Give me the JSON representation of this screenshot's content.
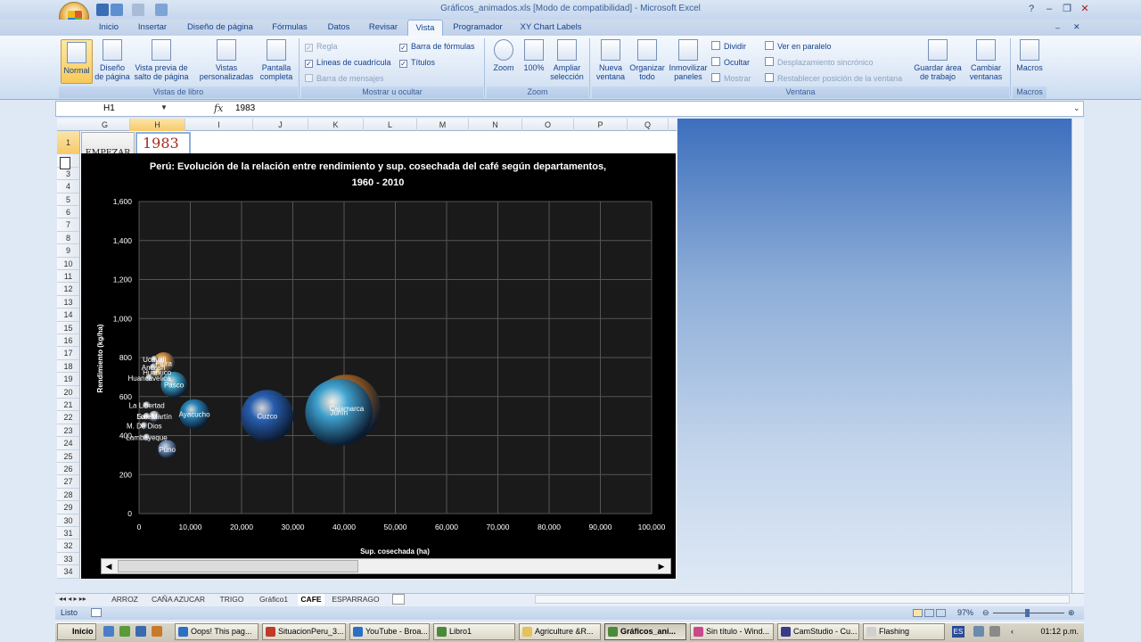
{
  "window": {
    "title": "Gráficos_animados.xls  [Modo de compatibilidad] - Microsoft Excel"
  },
  "ribbon": {
    "tabs": [
      "Inicio",
      "Insertar",
      "Diseño de página",
      "Fórmulas",
      "Datos",
      "Revisar",
      "Vista",
      "Programador",
      "XY Chart Labels"
    ],
    "active_tab": "Vista",
    "groups": {
      "vistas_libro": {
        "label": "Vistas de libro",
        "normal": "Normal",
        "diseno": "Diseño de página",
        "vista_previa": "Vista previa de salto de página",
        "vistas_pers": "Vistas personalizadas",
        "pantalla": "Pantalla completa"
      },
      "mostrar": {
        "label": "Mostrar u ocultar",
        "regla": "Regla",
        "lineas": "Líneas de cuadrícula",
        "barra_mensajes": "Barra de mensajes",
        "barra_formulas": "Barra de fórmulas",
        "titulos": "Títulos"
      },
      "zoom": {
        "label": "Zoom",
        "zoom": "Zoom",
        "cien": "100%",
        "ampliar": "Ampliar selección"
      },
      "ventana": {
        "label": "Ventana",
        "nueva": "Nueva ventana",
        "organizar": "Organizar todo",
        "inmovilizar": "Inmovilizar paneles",
        "dividir": "Dividir",
        "ocultar": "Ocultar",
        "mostrar": "Mostrar",
        "paralelo": "Ver en paralelo",
        "sincronico": "Desplazamiento sincrónico",
        "restablecer": "Restablecer posición de la ventana",
        "guardar": "Guardar área de trabajo",
        "cambiar": "Cambiar ventanas"
      },
      "macros": {
        "label": "Macros",
        "macros": "Macros"
      }
    }
  },
  "formula_bar": {
    "name_box": "H1",
    "fx": "fx",
    "value": "1983"
  },
  "sheet": {
    "columns": [
      "G",
      "H",
      "I",
      "J",
      "K",
      "L",
      "M",
      "N",
      "O",
      "P",
      "Q"
    ],
    "rows": [
      "1",
      "2",
      "3",
      "4",
      "5",
      "6",
      "7",
      "8",
      "9",
      "10",
      "11",
      "12",
      "13",
      "14",
      "15",
      "16",
      "17",
      "18",
      "19",
      "20",
      "21",
      "22",
      "23",
      "24",
      "25",
      "26",
      "27",
      "28",
      "29",
      "30",
      "31",
      "32",
      "33",
      "34"
    ],
    "button_label": "EMPEZAR",
    "year_value": "1983"
  },
  "chart_data": {
    "type": "scatter",
    "title": "Perú: Evolución de la relación entre rendimiento y sup. cosechada del café según departamentos, 1960 - 2010",
    "xlabel": "Sup. cosechada  (ha)",
    "ylabel": "Rendimiento  (kg/ha)",
    "xlim": [
      0,
      100000
    ],
    "ylim": [
      0,
      1600
    ],
    "x_ticks": [
      "0",
      "10,000",
      "20,000",
      "30,000",
      "40,000",
      "50,000",
      "60,000",
      "70,000",
      "80,000",
      "90,000",
      "100,000"
    ],
    "y_ticks": [
      "0",
      "200",
      "400",
      "600",
      "800",
      "1,000",
      "1,200",
      "1,400",
      "1,600"
    ],
    "grid": true,
    "points": [
      {
        "label": "Cajamarca",
        "x": 40500,
        "y": 540,
        "r": 9,
        "color": "#c66d17"
      },
      {
        "label": "Junín",
        "x": 39000,
        "y": 520,
        "r": 9,
        "color": "#3aa4d6"
      },
      {
        "label": "Cuzco",
        "x": 25000,
        "y": 500,
        "r": 7,
        "color": "#2a62b8"
      },
      {
        "label": "Ayacucho",
        "x": 10800,
        "y": 510,
        "r": 4,
        "color": "#2a8bc0"
      },
      {
        "label": "Pasco",
        "x": 6800,
        "y": 660,
        "r": 3.5,
        "color": "#3fa8cc"
      },
      {
        "label": "Piura",
        "x": 4800,
        "y": 770,
        "r": 3,
        "color": "#e39a44"
      },
      {
        "label": "Ucayali",
        "x": 3000,
        "y": 790,
        "r": 1,
        "color": "#cccccc"
      },
      {
        "label": "Ancash",
        "x": 2800,
        "y": 750,
        "r": 1,
        "color": "#cccccc"
      },
      {
        "label": "Huánuco",
        "x": 3500,
        "y": 725,
        "r": 1.5,
        "color": "#e8c060"
      },
      {
        "label": "Huancavelica",
        "x": 2000,
        "y": 695,
        "r": 1,
        "color": "#cccccc"
      },
      {
        "label": "La Libertad",
        "x": 1500,
        "y": 555,
        "r": 1,
        "color": "#cccccc"
      },
      {
        "label": "Loreto",
        "x": 1500,
        "y": 498,
        "r": 1,
        "color": "#cccccc"
      },
      {
        "label": "San Martín",
        "x": 3000,
        "y": 498,
        "r": 1.5,
        "color": "#cccccc"
      },
      {
        "label": "M. De Dios",
        "x": 1000,
        "y": 450,
        "r": 1,
        "color": "#cccccc"
      },
      {
        "label": "Lambayeque",
        "x": 1500,
        "y": 390,
        "r": 1,
        "color": "#cccccc"
      },
      {
        "label": "Puno",
        "x": 5500,
        "y": 330,
        "r": 2.5,
        "color": "#7e9bc4"
      }
    ]
  },
  "sheet_tabs": [
    "ARROZ",
    "CAÑA AZUCAR",
    "TRIGO",
    "Gráfico1",
    "CAFE",
    "ESPARRAGO"
  ],
  "active_sheet": "CAFE",
  "status": {
    "text": "Listo",
    "zoom": "97%"
  },
  "taskbar": {
    "start": "Inicio",
    "items": [
      "Oops! This pag...",
      "SituacionPeru_3...",
      "YouTube - Broa...",
      "Libro1",
      "Agriculture &R...",
      "Gráficos_ani...",
      "Sin título - Wind...",
      "CamStudio - Cu...",
      "Flashing"
    ],
    "active": "Gráficos_ani...",
    "lang": "ES",
    "clock": "01:12 p.m."
  }
}
